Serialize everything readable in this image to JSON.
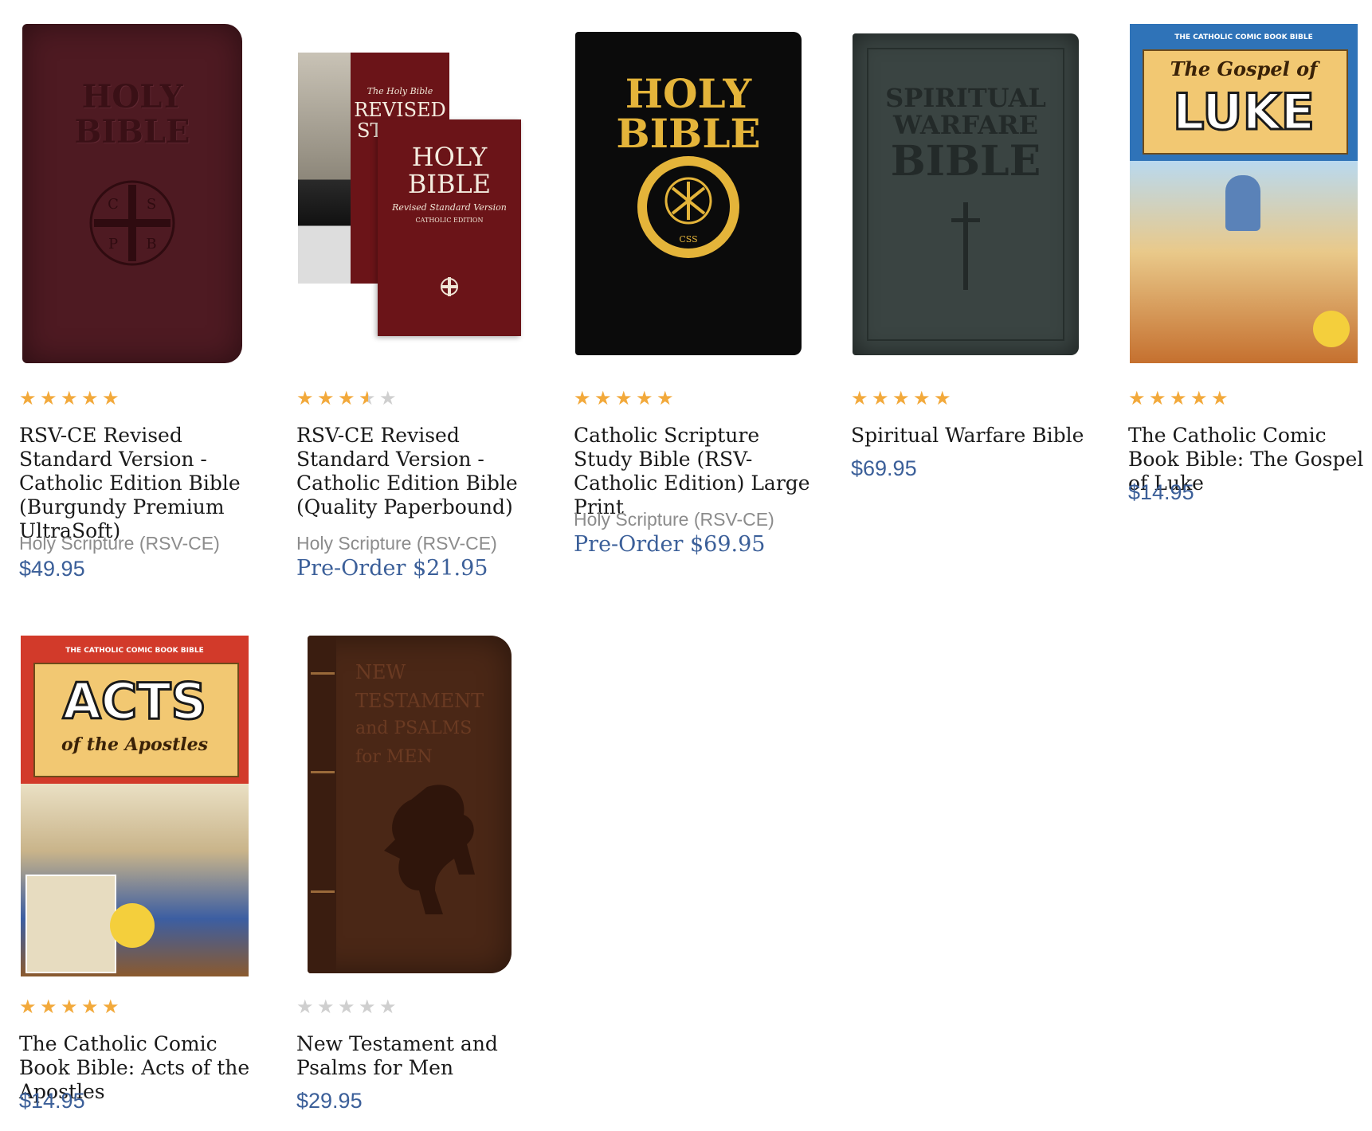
{
  "products": [
    {
      "title": "RSV-CE Revised Standard Version - Catholic Edition Bible (Burgundy Premium UltraSoft)",
      "category": "Holy Scripture (RSV-CE)",
      "price": "$49.95",
      "rating": 5,
      "cover": {
        "lines": [
          "HOLY",
          "BIBLE"
        ],
        "color": "#4e1a22",
        "letters": [
          "C",
          "S",
          "P",
          "B"
        ]
      }
    },
    {
      "title": "RSV-CE Revised Standard Version - Catholic Edition Bible (Quality Paperbound)",
      "category": "Holy Scripture (RSV-CE)",
      "price": "Pre-Order $21.95",
      "rating": 3.5,
      "cover": {
        "back_small": "The Holy Bible",
        "back_lines": [
          "REVISED",
          "STA"
        ],
        "front_lines": [
          "HOLY",
          "BIBLE"
        ],
        "front_sub": "Revised Standard Version",
        "front_small": "CATHOLIC EDITION",
        "color": "#6b1418"
      }
    },
    {
      "title": "Catholic Scripture Study Bible (RSV-Catholic Edition) Large Print",
      "category": "Holy Scripture (RSV-CE)",
      "price": "Pre-Order $69.95",
      "rating": 5,
      "cover": {
        "lines": [
          "HOLY",
          "BIBLE"
        ],
        "seal_text": "CSS",
        "color": "#0b0b0b",
        "accent": "#e4b43a"
      }
    },
    {
      "title": "Spiritual Warfare Bible",
      "category": "",
      "price": "$69.95",
      "rating": 5,
      "cover": {
        "lines": [
          "SPIRITUAL",
          "WARFARE",
          "BIBLE"
        ],
        "color": "#3a4442"
      }
    },
    {
      "title": "The Catholic Comic Book Bible: The Gospel of Luke",
      "category": "",
      "price": "$14.95",
      "rating": 5,
      "cover": {
        "series": "THE CATHOLIC COMIC BOOK BIBLE",
        "lines": [
          "The Gospel of",
          "LUKE"
        ],
        "color": "#2f73b8"
      }
    },
    {
      "title": "The Catholic Comic Book Bible: Acts of the Apostles",
      "category": "",
      "price": "$14.95",
      "rating": 5,
      "cover": {
        "series": "THE CATHOLIC COMIC BOOK BIBLE",
        "lines": [
          "ACTS",
          "of the Apostles"
        ],
        "color": "#d23a2a"
      }
    },
    {
      "title": "New Testament and Psalms for Men",
      "category": "",
      "price": "$29.95",
      "rating": 0,
      "cover": {
        "lines": [
          "NEW",
          "TESTAMENT",
          "and PSALMS",
          "for MEN"
        ],
        "color": "#4a2716"
      }
    }
  ],
  "colors": {
    "star": "#f2a93b",
    "star_empty": "#cfcfcf",
    "price": "#3b5f99",
    "category": "#8c8c8c"
  }
}
